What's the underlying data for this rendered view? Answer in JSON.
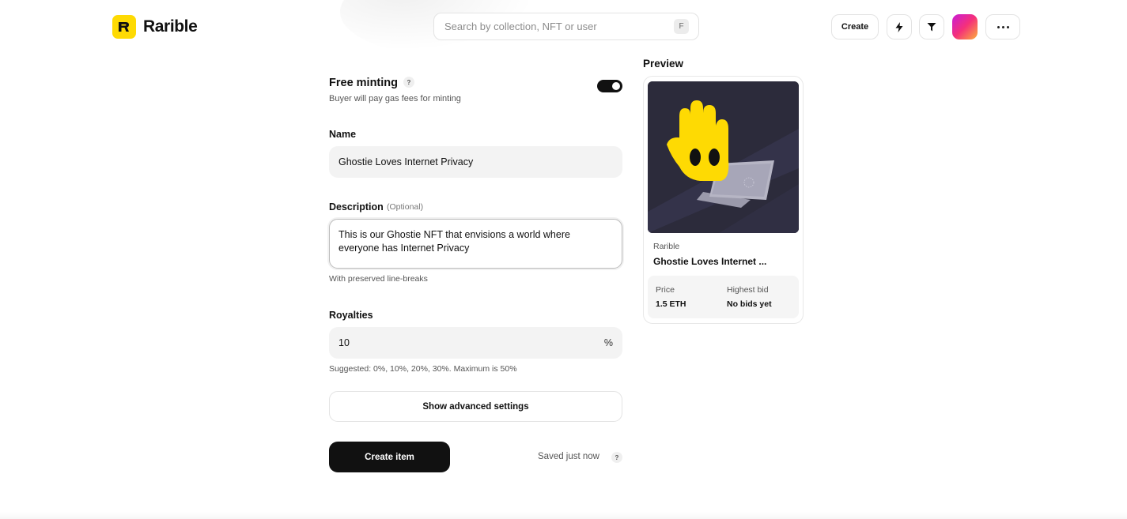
{
  "header": {
    "logo_text": "Rarible",
    "search_placeholder": "Search by collection, NFT or user",
    "search_shortcut": "F",
    "create_label": "Create",
    "icons": [
      "bolt-icon",
      "filter-icon",
      "avatar",
      "more-icon"
    ]
  },
  "form": {
    "free_minting": {
      "title": "Free minting",
      "help": "?",
      "subtitle": "Buyer will pay gas fees for minting",
      "enabled": true
    },
    "name": {
      "label": "Name",
      "value": "Ghostie Loves Internet Privacy"
    },
    "description": {
      "label": "Description",
      "optional": "(Optional)",
      "line1": "This is our Ghostie NFT that envisions a world where",
      "line2": "everyone has Internet Privacy",
      "helper": "With preserved line-breaks"
    },
    "royalties": {
      "label": "Royalties",
      "value": "10",
      "suffix": "%",
      "helper": "Suggested: 0%, 10%, 20%, 30%. Maximum is 50%"
    },
    "advanced_label": "Show advanced settings",
    "create_item_label": "Create item",
    "saved_text": "Saved just now",
    "saved_help": "?"
  },
  "preview": {
    "title": "Preview",
    "collection": "Rarible",
    "name": "Ghostie Loves Internet ...",
    "price_label": "Price",
    "price_value": "1.5 ETH",
    "bid_label": "Highest bid",
    "bid_value": "No bids yet"
  },
  "colors": {
    "brand_yellow": "#FEDA03",
    "primary_dark": "#111111",
    "artwork_bg": "#2C2B3B"
  }
}
